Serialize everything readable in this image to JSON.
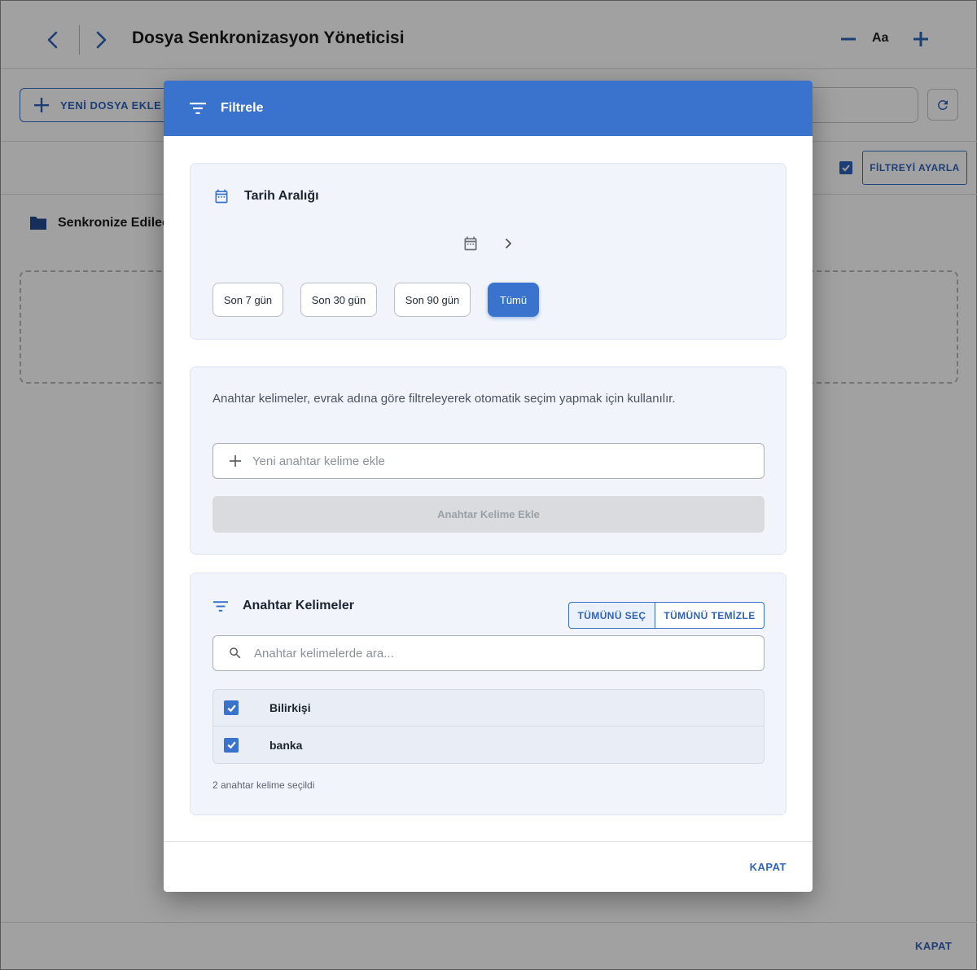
{
  "app": {
    "title": "Dosya Senkronizasyon Yöneticisi",
    "font_size_label": "Aa",
    "add_file_label": "YENİ DOSYA EKLE",
    "filter_button_label": "FİLTREYİ AYARLA",
    "section_title": "Senkronize Edilec",
    "footer_close_label": "KAPAT",
    "accent_color": "#3a73ce"
  },
  "dialog": {
    "title": "Filtrele",
    "date_range": {
      "title": "Tarih Aralığı",
      "presets": [
        "Son 7 gün",
        "Son 30 gün",
        "Son 90 gün",
        "Tümü"
      ],
      "selected_preset": "Tümü"
    },
    "keyword_add": {
      "description": "Anahtar kelimeler, evrak adına göre filtreleyerek otomatik seçim yapmak için kullanılır.",
      "input_placeholder": "Yeni anahtar kelime ekle",
      "input_value": "",
      "add_button_label": "Anahtar Kelime Ekle"
    },
    "keywords": {
      "title": "Anahtar Kelimeler",
      "select_all_label": "TÜMÜNÜ SEÇ",
      "clear_all_label": "TÜMÜNÜ TEMİZLE",
      "search_placeholder": "Anahtar kelimelerde ara...",
      "items": [
        {
          "label": "Bilirkişi",
          "checked": true
        },
        {
          "label": "banka",
          "checked": true
        }
      ],
      "selected_count_text": "2 anahtar kelime seçildi"
    },
    "close_label": "KAPAT"
  }
}
